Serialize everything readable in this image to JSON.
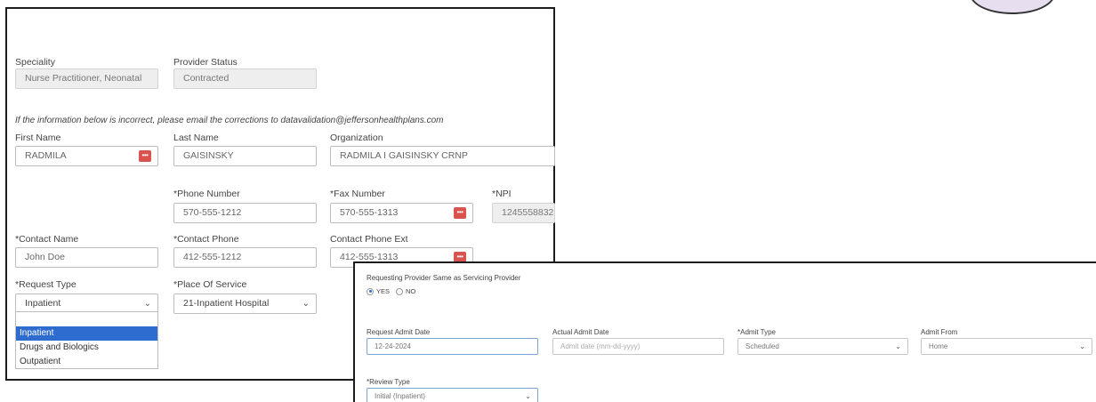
{
  "provider": {
    "speciality_label": "Speciality",
    "speciality_value": "Nurse Practitioner, Neonatal",
    "status_label": "Provider Status",
    "status_value": "Contracted"
  },
  "notice": "If the information below is incorrect, please email the corrections to datavalidation@jeffersonhealthplans.com",
  "contact": {
    "first_name_label": "First Name",
    "first_name_value": "RADMILA",
    "last_name_label": "Last Name",
    "last_name_value": "GAISINSKY",
    "organization_label": "Organization",
    "organization_value": "RADMILA I GAISINSKY CRNP",
    "phone_label": "*Phone Number",
    "phone_value": "570-555-1212",
    "fax_label": "*Fax Number",
    "fax_value": "570-555-1313",
    "npi_label": "*NPI",
    "npi_value": "1245558832",
    "contact_name_label": "*Contact Name",
    "contact_name_value": "John Doe",
    "contact_phone_label": "*Contact Phone",
    "contact_phone_value": "412-555-1212",
    "contact_ext_label": "Contact Phone Ext",
    "contact_ext_value": "412-555-1313"
  },
  "request": {
    "type_label": "*Request Type",
    "type_value": "Inpatient",
    "type_options": [
      "",
      "Inpatient",
      "Drugs and Biologics",
      "Outpatient"
    ],
    "place_label": "*Place Of Service",
    "place_value": "21-Inpatient Hospital"
  },
  "admission": {
    "same_provider_label": "Requesting Provider Same as Servicing Provider",
    "yes_label": "YES",
    "no_label": "NO",
    "request_date_label": "Request Admit Date",
    "request_date_value": "12-24-2024",
    "actual_date_label": "Actual Admit Date",
    "actual_date_placeholder": "Admit date (mm-dd-yyyy)",
    "admit_type_label": "*Admit Type",
    "admit_type_value": "Scheduled",
    "admit_from_label": "Admit From",
    "admit_from_value": "Home",
    "review_type_label": "*Review Type",
    "review_type_value": "Initial (Inpatient)"
  },
  "icons": {
    "more": "more-dots-icon",
    "dropdown": "chevron-down-icon"
  },
  "colors": {
    "accent": "#2f6cd0",
    "more_button": "#d9534f",
    "readonly_bg": "#eeeeee"
  }
}
